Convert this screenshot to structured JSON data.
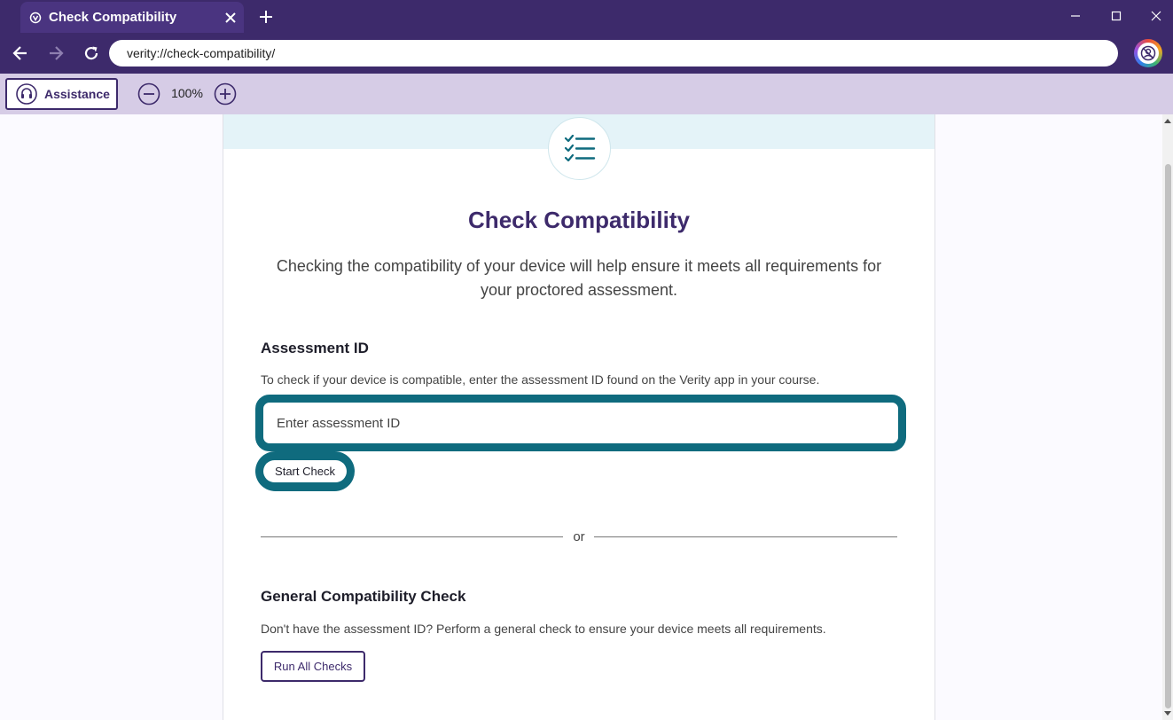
{
  "browser": {
    "tab_title": "Check Compatibility",
    "url": "verity://check-compatibility/",
    "accent_color": "#3d2a6b"
  },
  "toolbar": {
    "assistance_label": "Assistance",
    "zoom_level": "100%"
  },
  "main": {
    "title": "Check Compatibility",
    "intro_line1": "Checking the compatibility of your device will help ensure it meets all requirements for",
    "intro_line2": "your proctored assessment.",
    "assessment": {
      "heading": "Assessment ID",
      "description": "To check if your device is compatible, enter the assessment ID found on the Verity app in your course.",
      "input_placeholder": "Enter assessment ID",
      "input_value": "",
      "start_label": "Start Check"
    },
    "divider_text": "or",
    "general": {
      "heading": "General Compatibility Check",
      "description": "Don't have the assessment ID? Perform a general check to ensure your device meets all requirements.",
      "run_label": "Run All Checks"
    },
    "focus_color": "#0f6b7e"
  }
}
